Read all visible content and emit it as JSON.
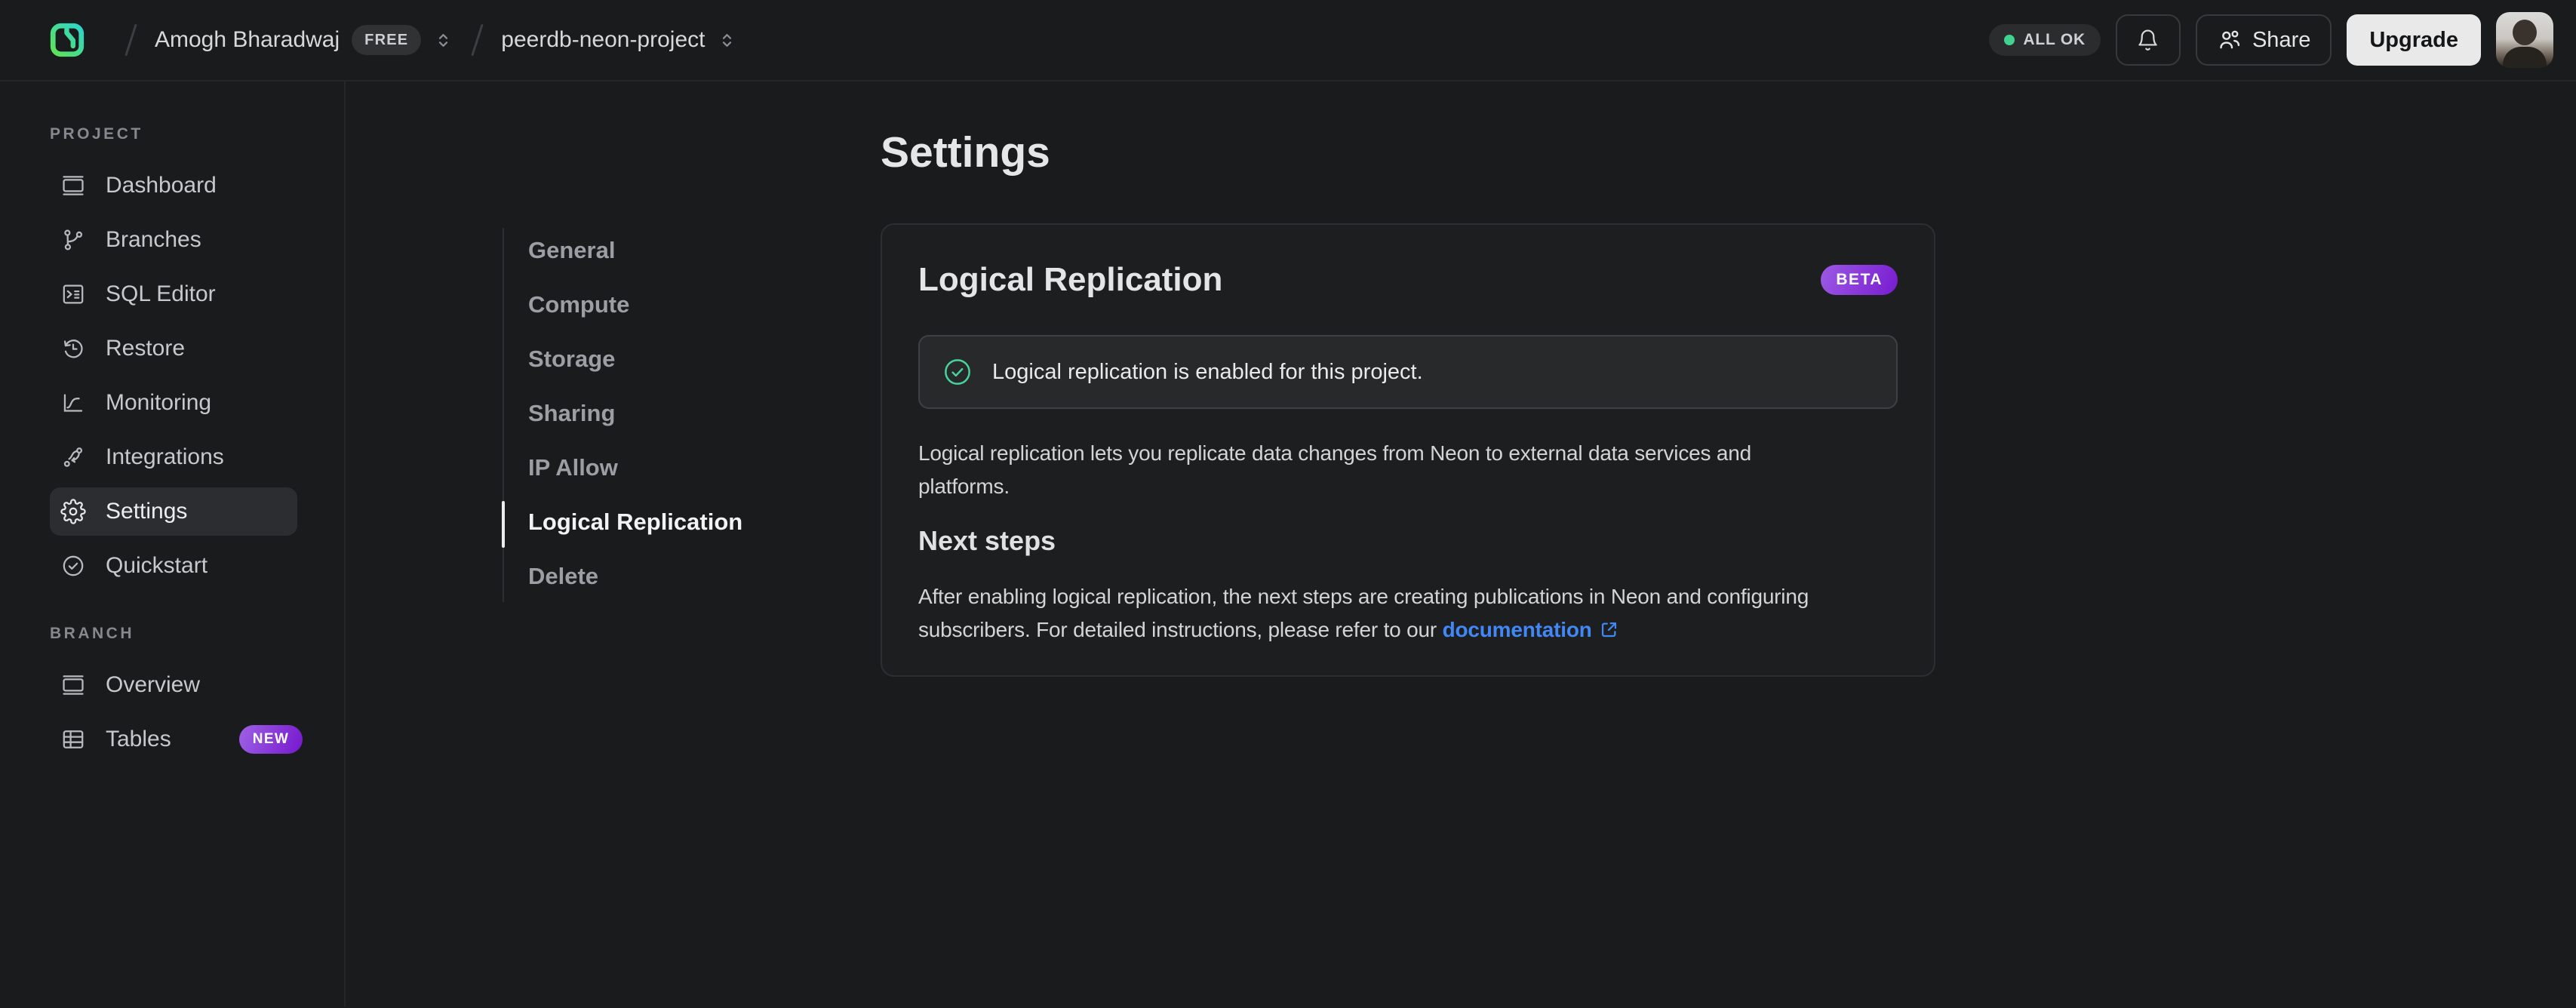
{
  "topbar": {
    "org_name": "Amogh Bharadwaj",
    "org_badge": "FREE",
    "project_name": "peerdb-neon-project",
    "status_label": "ALL OK",
    "share_label": "Share",
    "upgrade_label": "Upgrade"
  },
  "sidebar": {
    "project_label": "PROJECT",
    "project_items": [
      {
        "label": "Dashboard",
        "icon": "dashboard-icon",
        "active": false
      },
      {
        "label": "Branches",
        "icon": "branches-icon",
        "active": false
      },
      {
        "label": "SQL Editor",
        "icon": "sql-editor-icon",
        "active": false
      },
      {
        "label": "Restore",
        "icon": "restore-icon",
        "active": false
      },
      {
        "label": "Monitoring",
        "icon": "monitoring-icon",
        "active": false
      },
      {
        "label": "Integrations",
        "icon": "integrations-icon",
        "active": false
      },
      {
        "label": "Settings",
        "icon": "gear-icon",
        "active": true
      },
      {
        "label": "Quickstart",
        "icon": "quickstart-icon",
        "active": false
      }
    ],
    "branch_label": "BRANCH",
    "branch_items": [
      {
        "label": "Overview",
        "icon": "overview-icon",
        "badge": ""
      },
      {
        "label": "Tables",
        "icon": "tables-icon",
        "badge": "NEW"
      }
    ]
  },
  "settings_nav": {
    "items": [
      {
        "label": "General",
        "active": false
      },
      {
        "label": "Compute",
        "active": false
      },
      {
        "label": "Storage",
        "active": false
      },
      {
        "label": "Sharing",
        "active": false
      },
      {
        "label": "IP Allow",
        "active": false
      },
      {
        "label": "Logical Replication",
        "active": true
      },
      {
        "label": "Delete",
        "active": false
      }
    ]
  },
  "main": {
    "title": "Settings",
    "card": {
      "title": "Logical Replication",
      "badge": "BETA",
      "alert_text": "Logical replication is enabled for this project.",
      "description": "Logical replication lets you replicate data changes from Neon to external data services and\nplatforms.",
      "next_steps_title": "Next steps",
      "next_steps_before": "After enabling logical replication, the next steps are creating publications in Neon and configuring\nsubscribers. For detailed instructions, please refer to our ",
      "link_label": "documentation"
    }
  },
  "icons": {
    "neon-logo": "rounded square with N, green-teal gradient",
    "bell-icon": "notification bell outline",
    "people-icon": "two-person share glyph",
    "unfold-icon": "chevron up + chevron down",
    "check-circle-icon": "circled checkmark",
    "external-link-icon": "square with arrow out top-right",
    "status-dot": "small green circle"
  },
  "colors": {
    "background": "#1a1b1c",
    "card_background": "#1d1e20",
    "alert_background": "#27292b",
    "accent_green": "#40d390",
    "badge_purple_start": "#9a56e4",
    "badge_purple_end": "#7a1fd0",
    "link_blue": "#4287f6",
    "upgrade_button": "#e9e9ea"
  }
}
